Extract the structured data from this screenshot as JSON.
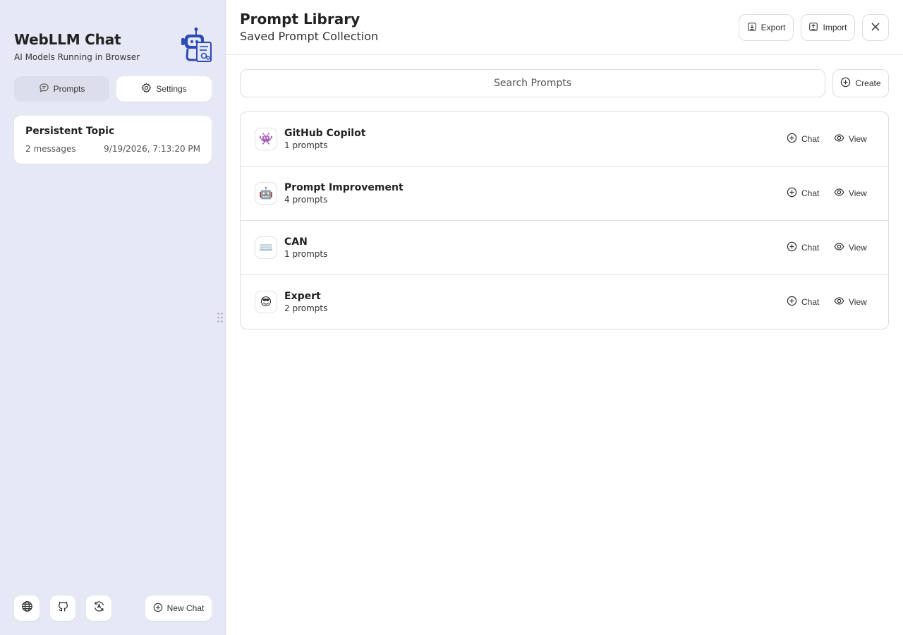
{
  "sidebar": {
    "title": "WebLLM Chat",
    "subtitle": "AI Models Running in Browser",
    "tabs": {
      "prompts_label": "Prompts",
      "settings_label": "Settings"
    },
    "chats": [
      {
        "title": "Persistent Topic",
        "count": "2 messages",
        "date": "9/19/2026, 7:13:20 PM"
      }
    ],
    "new_chat_label": "New Chat"
  },
  "header": {
    "title": "Prompt Library",
    "subtitle": "Saved Prompt Collection",
    "export_label": "Export",
    "import_label": "Import"
  },
  "search": {
    "placeholder": "Search Prompts",
    "create_label": "Create"
  },
  "prompts": [
    {
      "emoji": "👾",
      "name": "GitHub Copilot",
      "count": "1 prompts",
      "chat_label": "Chat",
      "view_label": "View"
    },
    {
      "emoji": "🤖",
      "name": "Prompt Improvement",
      "count": "4 prompts",
      "chat_label": "Chat",
      "view_label": "View"
    },
    {
      "emoji": "⌨️",
      "name": "CAN",
      "count": "1 prompts",
      "chat_label": "Chat",
      "view_label": "View"
    },
    {
      "emoji": "😎",
      "name": "Expert",
      "count": "2 prompts",
      "chat_label": "Chat",
      "view_label": "View"
    }
  ],
  "colors": {
    "sidebar_bg": "#e7e8f5",
    "logo_blue": "#2b4bb5",
    "border": "#dedede"
  }
}
